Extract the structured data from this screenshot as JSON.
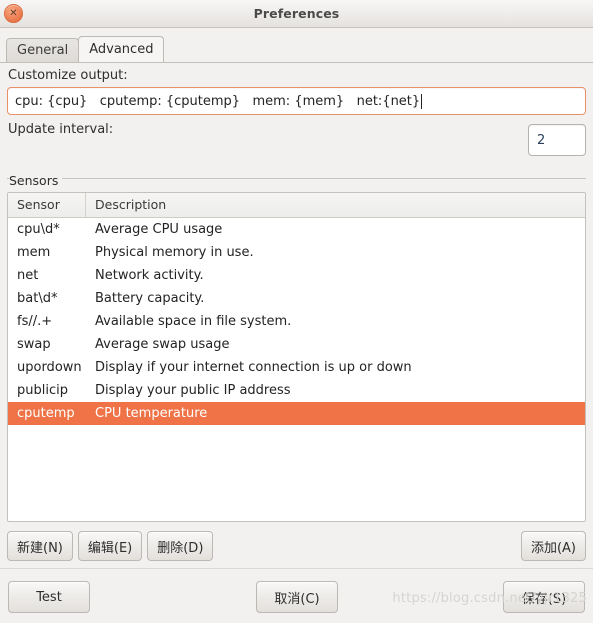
{
  "window": {
    "title": "Preferences",
    "close_icon": "close-icon",
    "close_glyph": "✕"
  },
  "tabs": [
    {
      "label": "General",
      "active": false
    },
    {
      "label": "Advanced",
      "active": true
    }
  ],
  "customize": {
    "label": "Customize output:",
    "value": "cpu: {cpu}   cputemp: {cputemp}   mem: {mem}   net:{net}",
    "placeholder": ""
  },
  "interval": {
    "label": "Update interval:",
    "value": "2"
  },
  "sensors": {
    "group_title": "Sensors",
    "columns": [
      "Sensor",
      "Description"
    ],
    "rows": [
      {
        "sensor": "cpu\\d*",
        "description": "Average CPU usage",
        "selected": false
      },
      {
        "sensor": "mem",
        "description": "Physical memory in use.",
        "selected": false
      },
      {
        "sensor": "net",
        "description": "Network activity.",
        "selected": false
      },
      {
        "sensor": "bat\\d*",
        "description": "Battery capacity.",
        "selected": false
      },
      {
        "sensor": "fs//.+",
        "description": "Available space in file system.",
        "selected": false
      },
      {
        "sensor": "swap",
        "description": "Average swap usage",
        "selected": false
      },
      {
        "sensor": "upordown",
        "description": "Display if your internet connection is up or down",
        "selected": false
      },
      {
        "sensor": "publicip",
        "description": "Display your public IP address",
        "selected": false
      },
      {
        "sensor": "cputemp",
        "description": "CPU temperature",
        "selected": true
      }
    ]
  },
  "actions": {
    "new": "新建(N)",
    "edit": "编辑(E)",
    "delete": "删除(D)",
    "add": "添加(A)"
  },
  "footer": {
    "test": "Test",
    "cancel": "取消(C)",
    "save": "保存(S)"
  },
  "watermark": "https://blog.csdn.net/yjr1325",
  "colors": {
    "selection": "#ef7347",
    "entry_focus_border": "#e8906a",
    "window_bg": "#f2f1f0"
  }
}
